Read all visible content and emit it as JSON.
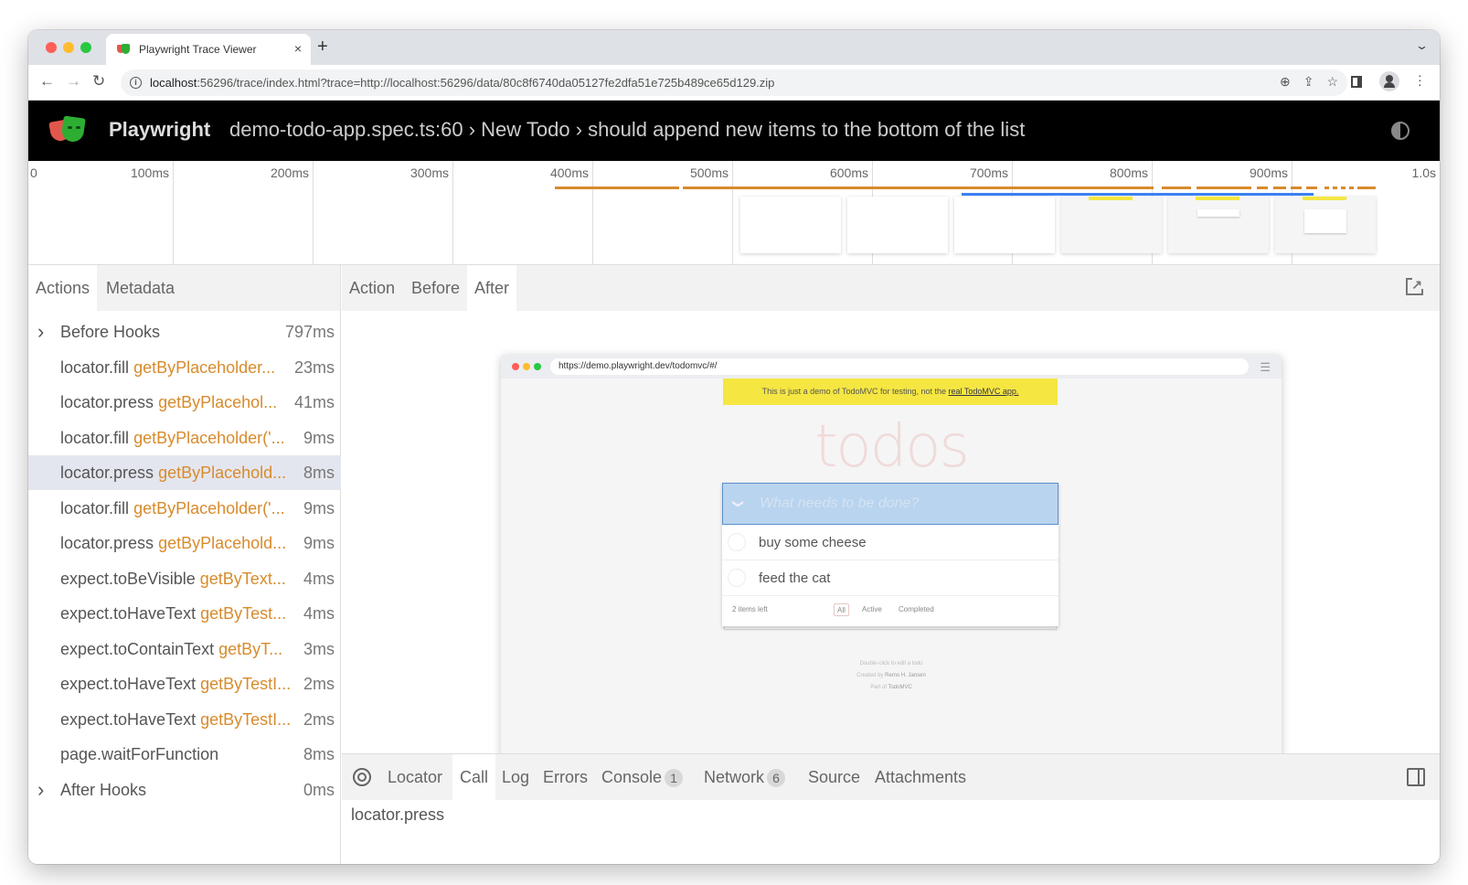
{
  "browser": {
    "tab_title": "Playwright Trace Viewer",
    "new_tab_label": "+",
    "close_label": "×",
    "url_host": "localhost",
    "url_rest": ":56296/trace/index.html?trace=http://localhost:56296/data/80c8f6740da05127fe2dfa51e725b489ce65d129.zip"
  },
  "header": {
    "app_name": "Playwright",
    "test_path": "demo-todo-app.spec.ts:60 › New Todo › should append new items to the bottom of the list"
  },
  "timeline": {
    "ticks": [
      "0",
      "100ms",
      "200ms",
      "300ms",
      "400ms",
      "500ms",
      "600ms",
      "700ms",
      "800ms",
      "900ms",
      "1.0s"
    ],
    "colors": {
      "action": "#d88b2c",
      "network": "#3b82f6"
    }
  },
  "left_panel": {
    "tabs": [
      "Actions",
      "Metadata"
    ],
    "actions": [
      {
        "name": "Before Hooks",
        "selector": "",
        "duration": "797ms",
        "expandable": true
      },
      {
        "name": "locator.fill",
        "selector": "getByPlaceholder...",
        "duration": "23ms"
      },
      {
        "name": "locator.press",
        "selector": "getByPlacehol...",
        "duration": "41ms"
      },
      {
        "name": "locator.fill",
        "selector": "getByPlaceholder('...",
        "duration": "9ms"
      },
      {
        "name": "locator.press",
        "selector": "getByPlacehold...",
        "duration": "8ms",
        "selected": true
      },
      {
        "name": "locator.fill",
        "selector": "getByPlaceholder('...",
        "duration": "9ms"
      },
      {
        "name": "locator.press",
        "selector": "getByPlacehold...",
        "duration": "9ms"
      },
      {
        "name": "expect.toBeVisible",
        "selector": "getByText...",
        "duration": "4ms"
      },
      {
        "name": "expect.toHaveText",
        "selector": "getByTest...",
        "duration": "4ms"
      },
      {
        "name": "expect.toContainText",
        "selector": "getByT...",
        "duration": "3ms"
      },
      {
        "name": "expect.toHaveText",
        "selector": "getByTestI...",
        "duration": "2ms"
      },
      {
        "name": "expect.toHaveText",
        "selector": "getByTestI...",
        "duration": "2ms"
      },
      {
        "name": "page.waitForFunction",
        "selector": "",
        "duration": "8ms"
      },
      {
        "name": "After Hooks",
        "selector": "",
        "duration": "0ms",
        "expandable": true
      }
    ]
  },
  "snapshot_tabs": [
    "Action",
    "Before",
    "After"
  ],
  "snapshot": {
    "url": "https://demo.playwright.dev/todomvc/#/",
    "banner_text": "This is just a demo of TodoMVC for testing, not the ",
    "banner_link": "real TodoMVC app.",
    "title": "todos",
    "new_todo_placeholder": "What needs to be done?",
    "toggle_all": "❯",
    "items": [
      "buy some cheese",
      "feed the cat"
    ],
    "items_left": "2 items left",
    "filters": [
      "All",
      "Active",
      "Completed"
    ],
    "info": [
      "Double-click to edit a todo",
      "Created by",
      "Remo H. Jansen",
      "Part of",
      "TodoMVC"
    ]
  },
  "bottom_panel": {
    "tabs": [
      {
        "label": "Locator"
      },
      {
        "label": "Call",
        "active": true
      },
      {
        "label": "Log"
      },
      {
        "label": "Errors"
      },
      {
        "label": "Console",
        "badge": "1"
      },
      {
        "label": "Network",
        "badge": "6"
      },
      {
        "label": "Source"
      },
      {
        "label": "Attachments"
      }
    ],
    "call_text": "locator.press"
  }
}
